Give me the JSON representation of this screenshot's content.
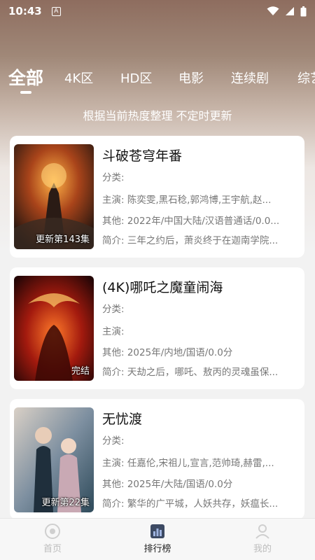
{
  "status_bar": {
    "time": "10:43",
    "notification_letter": "A"
  },
  "tabs": [
    {
      "label": "全部",
      "active": true
    },
    {
      "label": "4K区",
      "active": false
    },
    {
      "label": "HD区",
      "active": false
    },
    {
      "label": "电影",
      "active": false
    },
    {
      "label": "连续剧",
      "active": false
    },
    {
      "label": "综艺",
      "active": false
    }
  ],
  "subtitle": "根据当前热度整理 不定时更新",
  "items": [
    {
      "title": "斗破苍穹年番",
      "badge": "更新第143集",
      "category": "分类:",
      "cast": "主演:  陈奕雯,黑石稔,郭鸿博,王宇航,赵...",
      "other": "其他:  2022年/中国大陆/汉语普通话/0.0...",
      "intro": "简介:  三年之约后，萧炎终于在迦南学院..."
    },
    {
      "title": "(4K)哪吒之魔童闹海",
      "badge": "完结",
      "category": "分类:",
      "cast": "主演:",
      "other": "其他:  2025年/内地/国语/0.0分",
      "intro": "简介:  天劫之后，哪吒、敖丙的灵魂虽保..."
    },
    {
      "title": "无忧渡",
      "badge": "更新第22集",
      "category": "分类:",
      "cast": "主演:  任嘉伦,宋祖儿,宣言,范帅琦,赫雷,...",
      "other": "其他:  2025年/大陆/国语/0.0分",
      "intro": "简介:  繁华的广平城，人妖共存，妖瘟长..."
    }
  ],
  "bottom_nav": [
    {
      "label": "首页",
      "active": false
    },
    {
      "label": "排行榜",
      "active": true
    },
    {
      "label": "我的",
      "active": false
    }
  ],
  "colors": {
    "accent": "#111111",
    "inactive_nav": "#bdbdbd",
    "card_bg": "#ffffff"
  }
}
